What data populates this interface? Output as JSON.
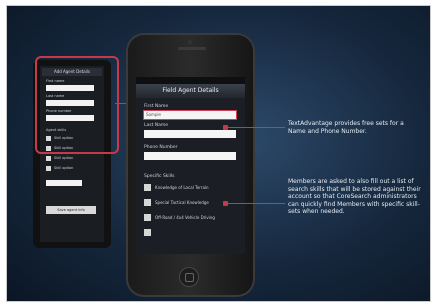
{
  "small_phone": {
    "bar_title": "Add Agent Details",
    "label_first": "First name",
    "label_last": "Last name",
    "label_phone": "Phone number",
    "label_skills": "Agent skills",
    "check_labels": [
      "Skill option",
      "Skill option",
      "Skill option",
      "Skill option"
    ],
    "button": "Save agent info"
  },
  "phone": {
    "carrier": "",
    "nav_title": "Field Agent Details",
    "first_name_label": "First Name",
    "first_name_value": "Sample",
    "last_name_label": "Last Name",
    "phone_label": "Phone Number",
    "skills_label": "Specific Skills",
    "skills": [
      "Knowledge of Local Terrain",
      "Special Tactical Knowledge",
      "Off-Road / 4x4 Vehicle Driving"
    ]
  },
  "callouts": {
    "top": "TextAdvantage provides free sets for a Name and Phone Number.",
    "bottom": "Members are asked to also fill out a list of search skills that will be stored against their account so that CoreSearch administrators can quickly find Members with specific skill-sets when needed."
  },
  "colors": {
    "accent": "#c43a4a",
    "background": "#1b3350"
  }
}
